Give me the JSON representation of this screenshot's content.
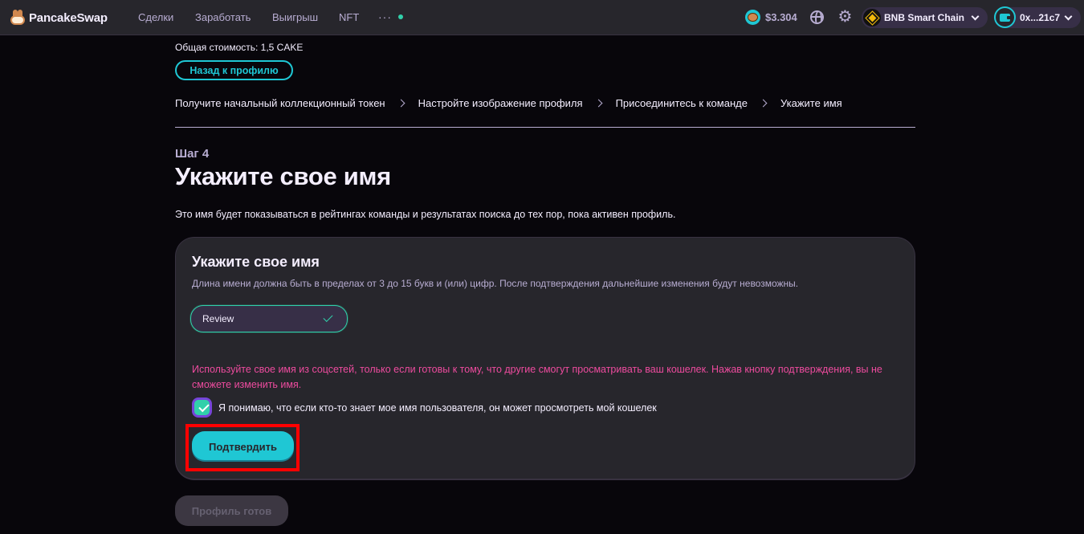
{
  "nav": {
    "brand": "PancakeSwap",
    "links": [
      "Сделки",
      "Заработать",
      "Выигрыш",
      "NFT"
    ],
    "more": "···",
    "cake_price": "$3.304",
    "chain": "BNB Smart Chain",
    "wallet": "0x...21c7"
  },
  "profile": {
    "total_cost": "Общая стоимость: 1,5 CAKE",
    "back_label": "Назад к профилю",
    "breadcrumbs": [
      "Получите начальный коллекционный токен",
      "Настройте изображение профиля",
      "Присоединитесь к команде",
      "Укажите имя"
    ],
    "step": "Шаг 4",
    "title": "Укажите свое имя",
    "description": "Это имя будет показываться в рейтингах команды и результатах поиска до тех пор, пока активен профиль."
  },
  "card": {
    "title": "Укажите свое имя",
    "hint": "Длина имени должна быть в пределах от 3 до 15 букв и (или) цифр. После подтверждения дальнейшие изменения будут невозможны.",
    "input_value": "Review",
    "warning": "Используйте свое имя из соцсетей, только если готовы к тому, что другие смогут просматривать ваш кошелек. Нажав кнопку подтверждения, вы не сможете изменить имя.",
    "agree_checked": true,
    "agree_text": "Я понимаю, что если кто-то знает мое имя пользователя, он может просмотреть мой кошелек",
    "confirm_label": "Подтвердить"
  },
  "ready_label": "Профиль готов",
  "colors": {
    "accent": "#1fc7d4",
    "success": "#31d0aa",
    "warning": "#ed4b9e",
    "highlight": "#ff0000"
  }
}
